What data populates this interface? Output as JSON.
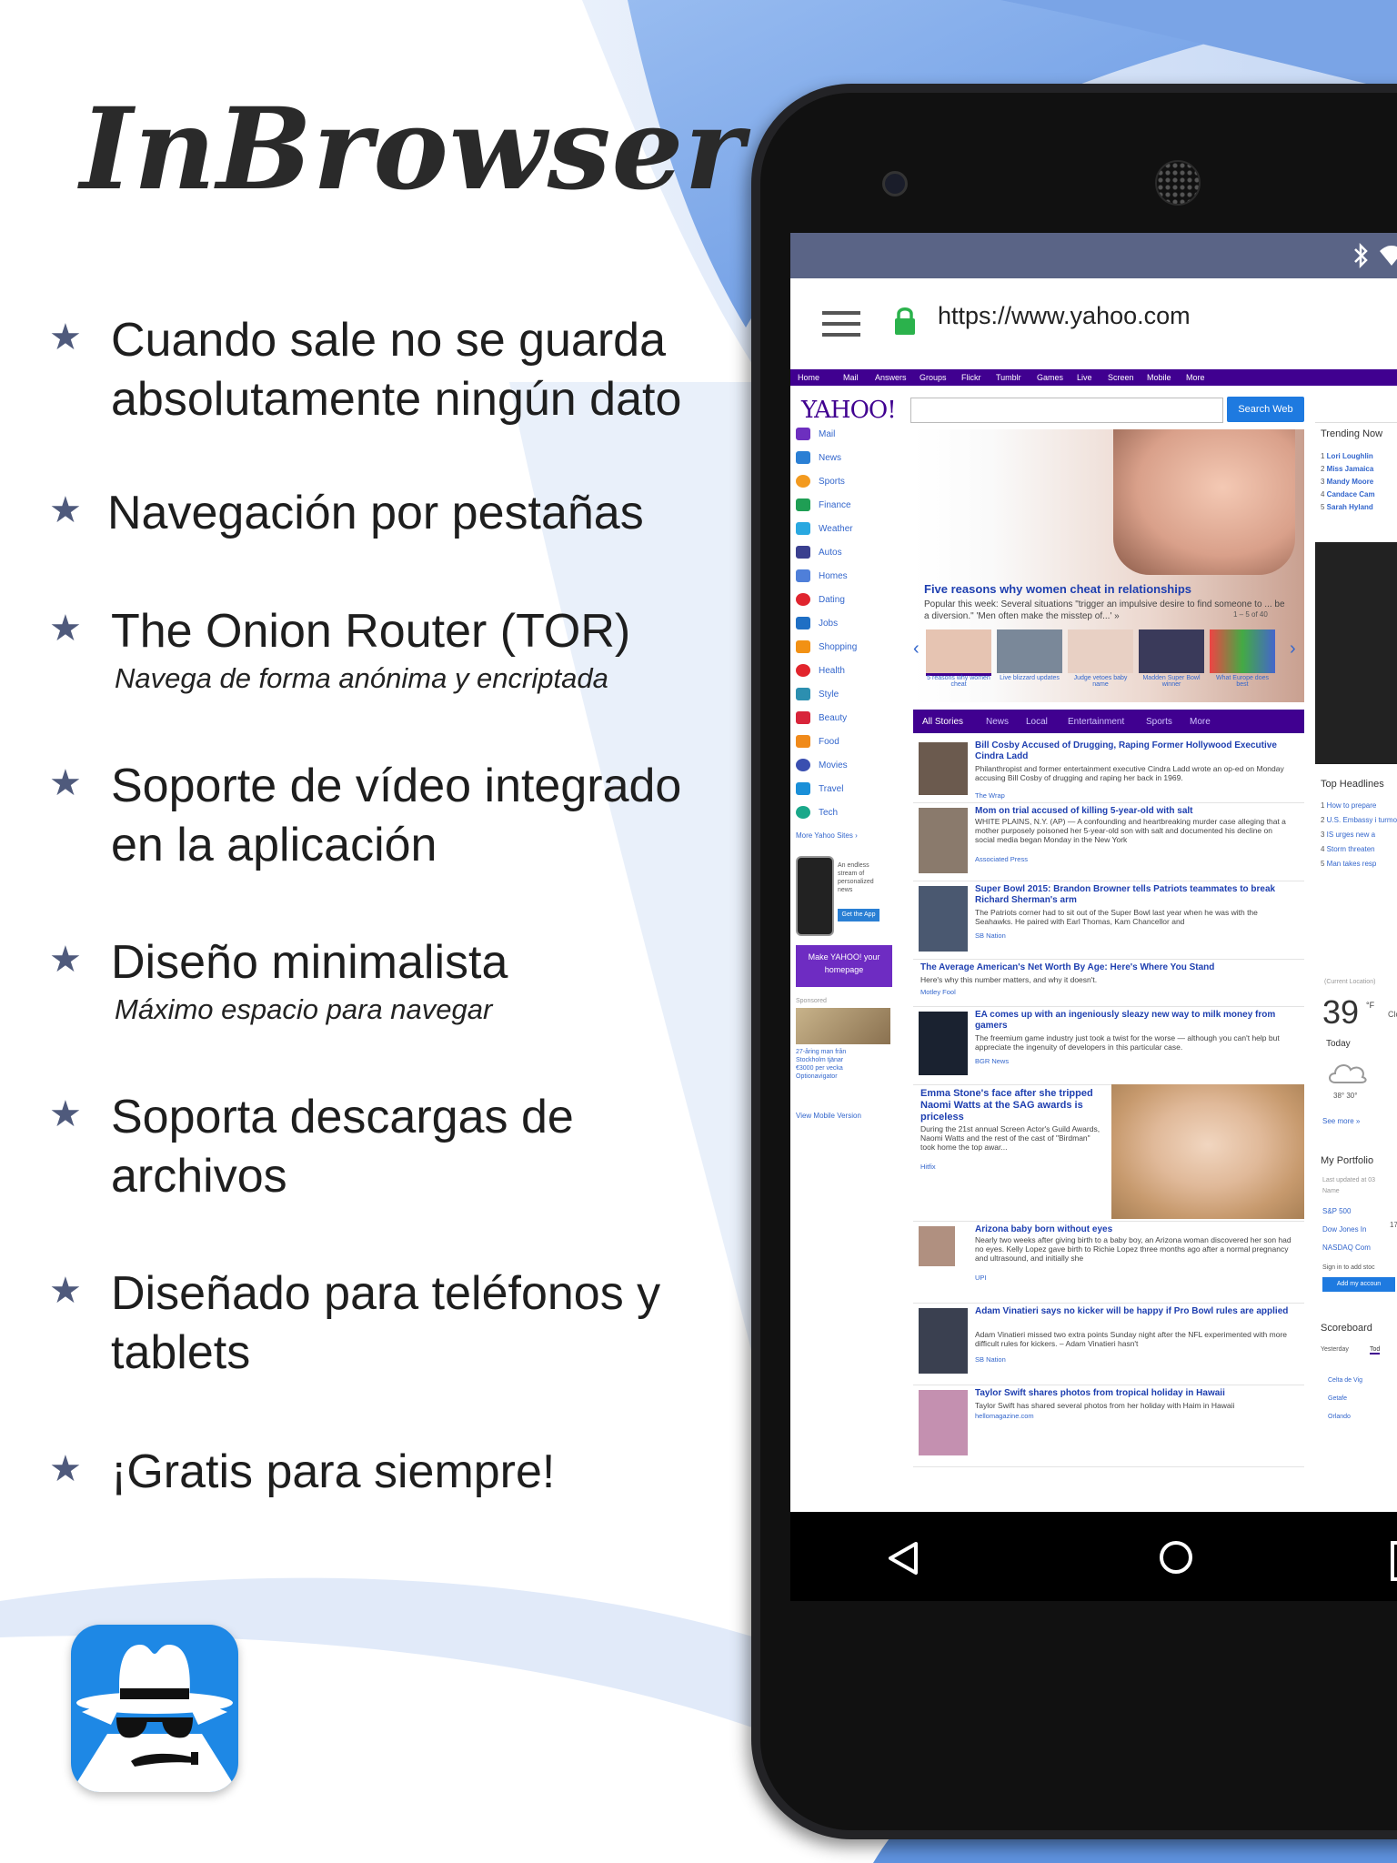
{
  "app": {
    "title": "InBrowser",
    "features": [
      {
        "text": "Cuando sale no se guarda absolutamente ningún dato",
        "sub": ""
      },
      {
        "text": "Navegación por pestañas",
        "sub": ""
      },
      {
        "text": "The Onion Router (TOR)",
        "sub": "Navega de forma anónima y encriptada"
      },
      {
        "text": "Soporte de vídeo integrado en la aplicación",
        "sub": ""
      },
      {
        "text": "Diseño minimalista",
        "sub": "Máximo espacio para navegar"
      },
      {
        "text": "Soporta descargas de archivos",
        "sub": ""
      },
      {
        "text": "Diseñado para teléfonos y tablets",
        "sub": ""
      },
      {
        "text": "¡Gratis para siempre!",
        "sub": ""
      }
    ],
    "icon": "incognito-hat-glasses-icon"
  },
  "browser": {
    "url": "https://www.yahoo.com",
    "status_icons": [
      "bluetooth-icon",
      "wifi-icon"
    ]
  },
  "yahoo": {
    "logo": "YAHOO!",
    "search_button": "Search Web",
    "topnav": [
      "Home",
      "Mail",
      "Answers",
      "Groups",
      "Flickr",
      "Tumblr",
      "Games",
      "Live",
      "Screen",
      "Mobile",
      "More"
    ],
    "sidebar": [
      "Mail",
      "News",
      "Sports",
      "Finance",
      "Weather",
      "Autos",
      "Homes",
      "Dating",
      "Jobs",
      "Shopping",
      "Health",
      "Style",
      "Beauty",
      "Food",
      "Movies",
      "Travel",
      "Tech"
    ],
    "more_sites": "More Yahoo Sites ›",
    "view_mobile": "View Mobile Version",
    "make_homepage": "Make YAHOO! your homepage",
    "hero": {
      "title": "Five reasons why women cheat in relationships",
      "desc": "Popular this week: Several situations \"trigger an impulsive desire to find someone to ... be a diversion.\" 'Men often make the misstep of...' »",
      "counter": "1 – 5 of 40",
      "thumbs": [
        "5 reasons why women cheat",
        "Live blizzard updates",
        "Judge vetoes baby name",
        "Madden Super Bowl winner",
        "What Europe does best"
      ]
    },
    "tabs": [
      "All Stories",
      "News",
      "Local",
      "Entertainment",
      "Sports",
      "More"
    ],
    "stories": [
      {
        "title": "Bill Cosby Accused of Drugging, Raping Former Hollywood Executive Cindra Ladd",
        "body": "Philanthropist and former entertainment executive Cindra Ladd wrote an op-ed on Monday accusing Bill Cosby of drugging and raping her back in 1969.",
        "src": "The Wrap"
      },
      {
        "title": "Mom on trial accused of killing 5-year-old with salt",
        "body": "WHITE PLAINS, N.Y. (AP) — A confounding and heartbreaking murder case alleging that a mother purposely poisoned her 5-year-old son with salt and documented his decline on social media began Monday in the New York",
        "src": "Associated Press"
      },
      {
        "title": "Super Bowl 2015: Brandon Browner tells Patriots teammates to break Richard Sherman's arm",
        "body": "The Patriots corner had to sit out of the Super Bowl last year when he was with the Seahawks. He paired with Earl Thomas, Kam Chancellor and",
        "src": "SB Nation"
      },
      {
        "title": "The Average American's Net Worth By Age: Here's Where You Stand",
        "body": "Here's why this number matters, and why it doesn't.",
        "src": "Motley Fool"
      },
      {
        "title": "EA comes up with an ingeniously sleazy new way to milk money from gamers",
        "body": "The freemium game industry just took a twist for the worse — although you can't help but appreciate the ingenuity of developers in this particular case.",
        "src": "BGR News"
      },
      {
        "title": "Emma Stone's face after she tripped Naomi Watts at the SAG awards is priceless",
        "body": "During the 21st annual Screen Actor's Guild Awards, Naomi Watts and the rest of the cast of \"Birdman\" took home the top awar...",
        "src": "Hitfix"
      },
      {
        "title": "Arizona baby born without eyes",
        "body": "Nearly two weeks after giving birth to a baby boy, an Arizona woman discovered her son had no eyes. Kelly Lopez gave birth to Richie Lopez three months ago after a normal pregnancy and ultrasound, and initially she",
        "src": "UPI"
      },
      {
        "title": "Adam Vinatieri says no kicker will be happy if Pro Bowl rules are applied",
        "body": "Adam Vinatieri missed two extra points Sunday night after the NFL experimented with more difficult rules for kickers. – Adam Vinatieri hasn't",
        "src": "SB Nation"
      },
      {
        "title": "Taylor Swift shares photos from tropical holiday in Hawaii",
        "body": "Taylor Swift has shared several photos from her holiday with Haim in Hawaii",
        "src": "hellomagazine.com"
      }
    ],
    "right": {
      "trending_title": "Trending Now",
      "trending": [
        "Lori Loughlin",
        "Miss Jamaica",
        "Mandy Moore",
        "Candace Cam",
        "Sarah Hyland"
      ],
      "headlines_title": "Top Headlines",
      "headlines": [
        "How to prepare",
        "U.S. Embassy i turmoil",
        "IS urges new a",
        "Storm threaten",
        "Man takes resp"
      ],
      "weather_loc": "(Current Location)",
      "temp": "39",
      "unit": "°F",
      "cond": "Clou",
      "today": "Today",
      "hilo": "38° 30°",
      "see_more": "See more »",
      "portfolio_title": "My Portfolio",
      "portfolio_updated": "Last updated at 03",
      "portfolio_name": "Name",
      "portfolio_items": [
        "S&P 500",
        "Dow Jones In",
        "NASDAQ Com"
      ],
      "portfolio_value": "17",
      "signin": "Sign in to add stoc",
      "add_account": "Add my accoun",
      "scoreboard_title": "Scoreboard",
      "scoreboard_tabs": [
        "Yesterday",
        "Tod"
      ],
      "teams": [
        "Celta de Vig",
        "Getafe",
        "Orlando"
      ]
    },
    "app_promo": "An endless stream of personalized news",
    "get_app": "Get the App",
    "sponsored": "Sponsored",
    "ad_text": "27-åring man från Stockholm tjänar €3000 per vecka Optionavigator"
  }
}
